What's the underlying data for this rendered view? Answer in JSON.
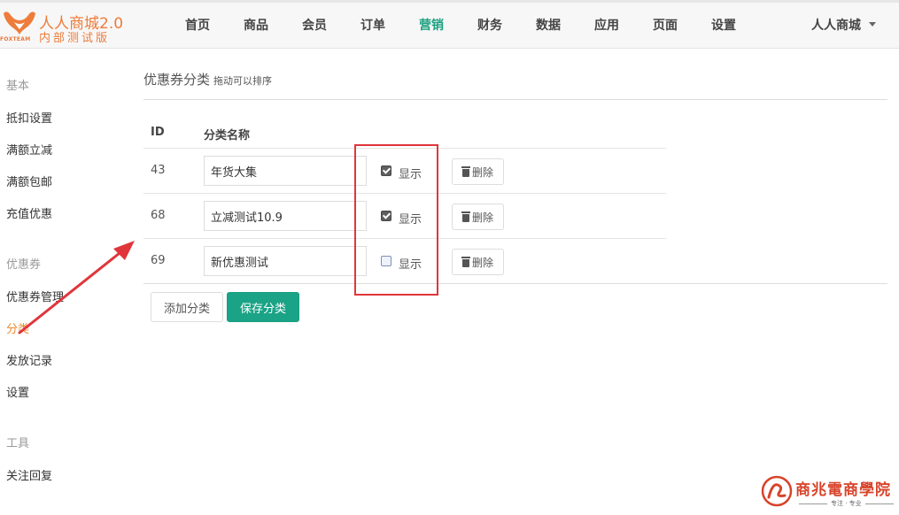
{
  "brand": {
    "title": "人人商城2.0",
    "tagline": "内部测试版",
    "sub": "FOXTEAM",
    "color": "#ee7c3a"
  },
  "nav": {
    "items": [
      {
        "label": "首页"
      },
      {
        "label": "商品"
      },
      {
        "label": "会员"
      },
      {
        "label": "订单"
      },
      {
        "label": "营销",
        "active": true
      },
      {
        "label": "财务"
      },
      {
        "label": "数据"
      },
      {
        "label": "应用"
      },
      {
        "label": "页面"
      },
      {
        "label": "设置"
      }
    ],
    "active_color": "#1aa07e",
    "user": "人人商城"
  },
  "sidebar": {
    "groups": [
      {
        "title": "基本",
        "items": [
          "抵扣设置",
          "满额立减",
          "满额包邮",
          "充值优惠"
        ]
      },
      {
        "title": "优惠券",
        "items": [
          "优惠券管理",
          "分类",
          "发放记录",
          "设置"
        ]
      },
      {
        "title": "工具",
        "items": [
          "关注回复"
        ]
      }
    ],
    "active_item": "分类",
    "active_color": "#ee8a2f"
  },
  "page": {
    "title": "优惠券分类",
    "hint": "拖动可以排序"
  },
  "table": {
    "columns": [
      "ID",
      "分类名称"
    ],
    "rows": [
      {
        "id": "43",
        "name": "年货大集",
        "show": true,
        "show_label": "显示",
        "delete_label": "删除"
      },
      {
        "id": "68",
        "name": "立减测试10.9",
        "show": true,
        "show_label": "显示",
        "delete_label": "删除"
      },
      {
        "id": "69",
        "name": "新优惠测试",
        "show": false,
        "show_label": "显示",
        "delete_label": "删除"
      }
    ]
  },
  "actions": {
    "add_label": "添加分类",
    "save_label": "保存分类",
    "save_color": "#1aa386"
  },
  "annotation": {
    "color": "#e0353b"
  },
  "watermark": {
    "text": "商兆電商學院",
    "sub": "专注 · 专业"
  }
}
